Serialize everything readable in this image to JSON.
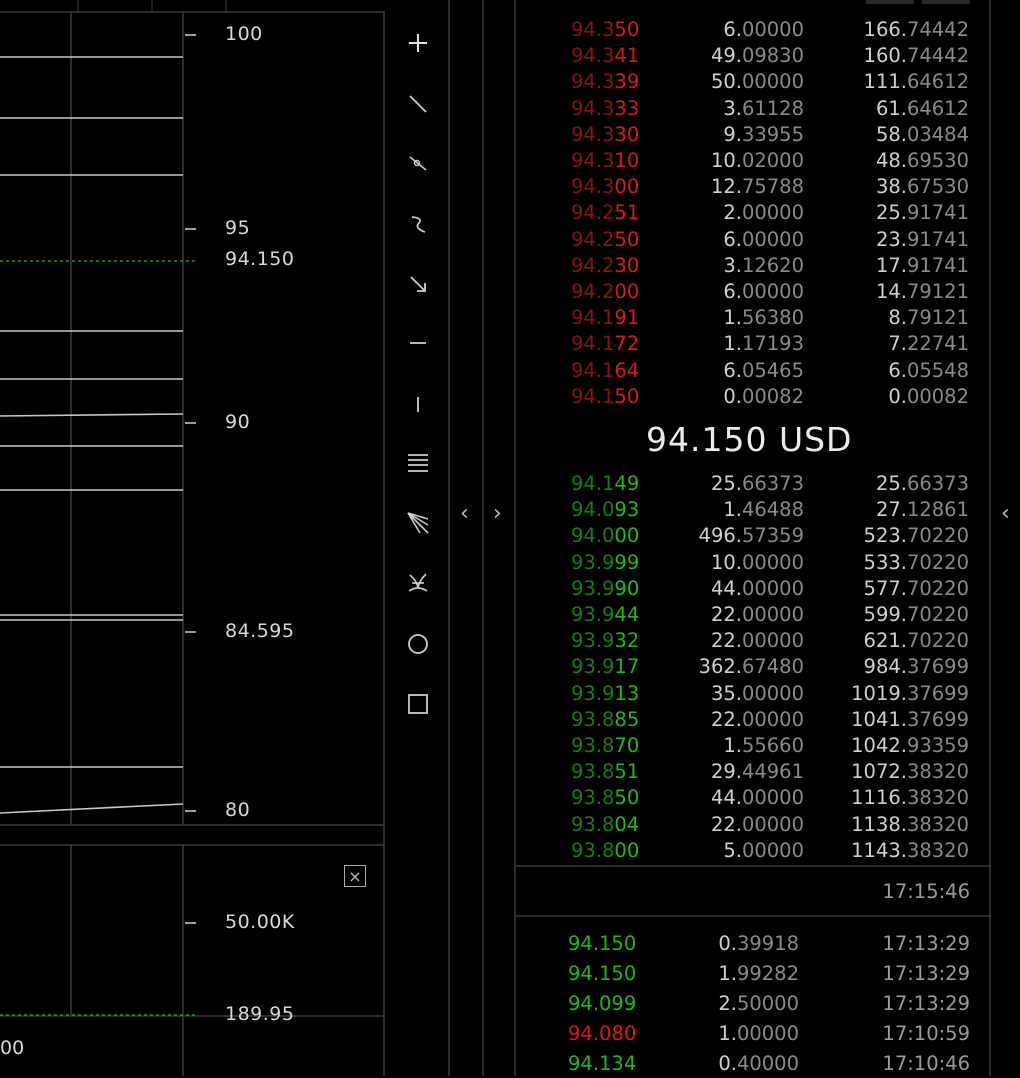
{
  "chart": {
    "price_axis": {
      "ticks": [
        "100",
        "95",
        "90",
        "84.595",
        "80"
      ],
      "current_price": "94.150"
    },
    "volume_axis": {
      "ticks": [
        "50.00K"
      ],
      "current_volume": "189.95"
    },
    "x_axis_partial_label": "00",
    "close_label": "×"
  },
  "toolbar": {
    "tools": [
      "crosshair-icon",
      "trend-line-icon",
      "ray-icon",
      "freehand-icon",
      "arrow-icon",
      "horizontal-line-icon",
      "vertical-line-icon",
      "parallel-lines-icon",
      "fan-icon",
      "pitchfork-icon",
      "circle-icon",
      "rectangle-icon"
    ]
  },
  "collapse": {
    "left_arrow": "‹",
    "right_arrow": "›",
    "far_left_arrow": "‹"
  },
  "order_book": {
    "asks": [
      {
        "price": "94.350",
        "amount": "6.00000",
        "total": "166.74442"
      },
      {
        "price": "94.341",
        "amount": "49.09830",
        "total": "160.74442"
      },
      {
        "price": "94.339",
        "amount": "50.00000",
        "total": "111.64612"
      },
      {
        "price": "94.333",
        "amount": "3.61128",
        "total": "61.64612"
      },
      {
        "price": "94.330",
        "amount": "9.33955",
        "total": "58.03484"
      },
      {
        "price": "94.310",
        "amount": "10.02000",
        "total": "48.69530"
      },
      {
        "price": "94.300",
        "amount": "12.75788",
        "total": "38.67530"
      },
      {
        "price": "94.251",
        "amount": "2.00000",
        "total": "25.91741"
      },
      {
        "price": "94.250",
        "amount": "6.00000",
        "total": "23.91741"
      },
      {
        "price": "94.230",
        "amount": "3.12620",
        "total": "17.91741"
      },
      {
        "price": "94.200",
        "amount": "6.00000",
        "total": "14.79121"
      },
      {
        "price": "94.191",
        "amount": "1.56380",
        "total": "8.79121"
      },
      {
        "price": "94.172",
        "amount": "1.17193",
        "total": "7.22741"
      },
      {
        "price": "94.164",
        "amount": "6.05465",
        "total": "6.05548"
      },
      {
        "price": "94.150",
        "amount": "0.00082",
        "total": "0.00082"
      }
    ],
    "mid_price": "94.150 USD",
    "bids": [
      {
        "price": "94.149",
        "amount": "25.66373",
        "total": "25.66373"
      },
      {
        "price": "94.093",
        "amount": "1.46488",
        "total": "27.12861"
      },
      {
        "price": "94.000",
        "amount": "496.57359",
        "total": "523.70220"
      },
      {
        "price": "93.999",
        "amount": "10.00000",
        "total": "533.70220"
      },
      {
        "price": "93.990",
        "amount": "44.00000",
        "total": "577.70220"
      },
      {
        "price": "93.944",
        "amount": "22.00000",
        "total": "599.70220"
      },
      {
        "price": "93.932",
        "amount": "22.00000",
        "total": "621.70220"
      },
      {
        "price": "93.917",
        "amount": "362.67480",
        "total": "984.37699"
      },
      {
        "price": "93.913",
        "amount": "35.00000",
        "total": "1019.37699"
      },
      {
        "price": "93.885",
        "amount": "22.00000",
        "total": "1041.37699"
      },
      {
        "price": "93.870",
        "amount": "1.55660",
        "total": "1042.93359"
      },
      {
        "price": "93.851",
        "amount": "29.44961",
        "total": "1072.38320"
      },
      {
        "price": "93.850",
        "amount": "44.00000",
        "total": "1116.38320"
      },
      {
        "price": "93.804",
        "amount": "22.00000",
        "total": "1138.38320"
      },
      {
        "price": "93.800",
        "amount": "5.00000",
        "total": "1143.38320"
      }
    ],
    "updated_time": "17:15:46"
  },
  "trades": [
    {
      "price": "94.150",
      "amount": "0.39918",
      "time": "17:13:29",
      "side": "buy"
    },
    {
      "price": "94.150",
      "amount": "1.99282",
      "time": "17:13:29",
      "side": "buy"
    },
    {
      "price": "94.099",
      "amount": "2.50000",
      "time": "17:13:29",
      "side": "buy"
    },
    {
      "price": "94.080",
      "amount": "1.00000",
      "time": "17:10:59",
      "side": "sell"
    },
    {
      "price": "94.134",
      "amount": "0.40000",
      "time": "17:10:46",
      "side": "buy"
    }
  ],
  "colors": {
    "ask": "#d81a1a",
    "bid": "#1fb81f",
    "current_price_line": "#1fb81f",
    "grid": "#3a3a3a"
  }
}
